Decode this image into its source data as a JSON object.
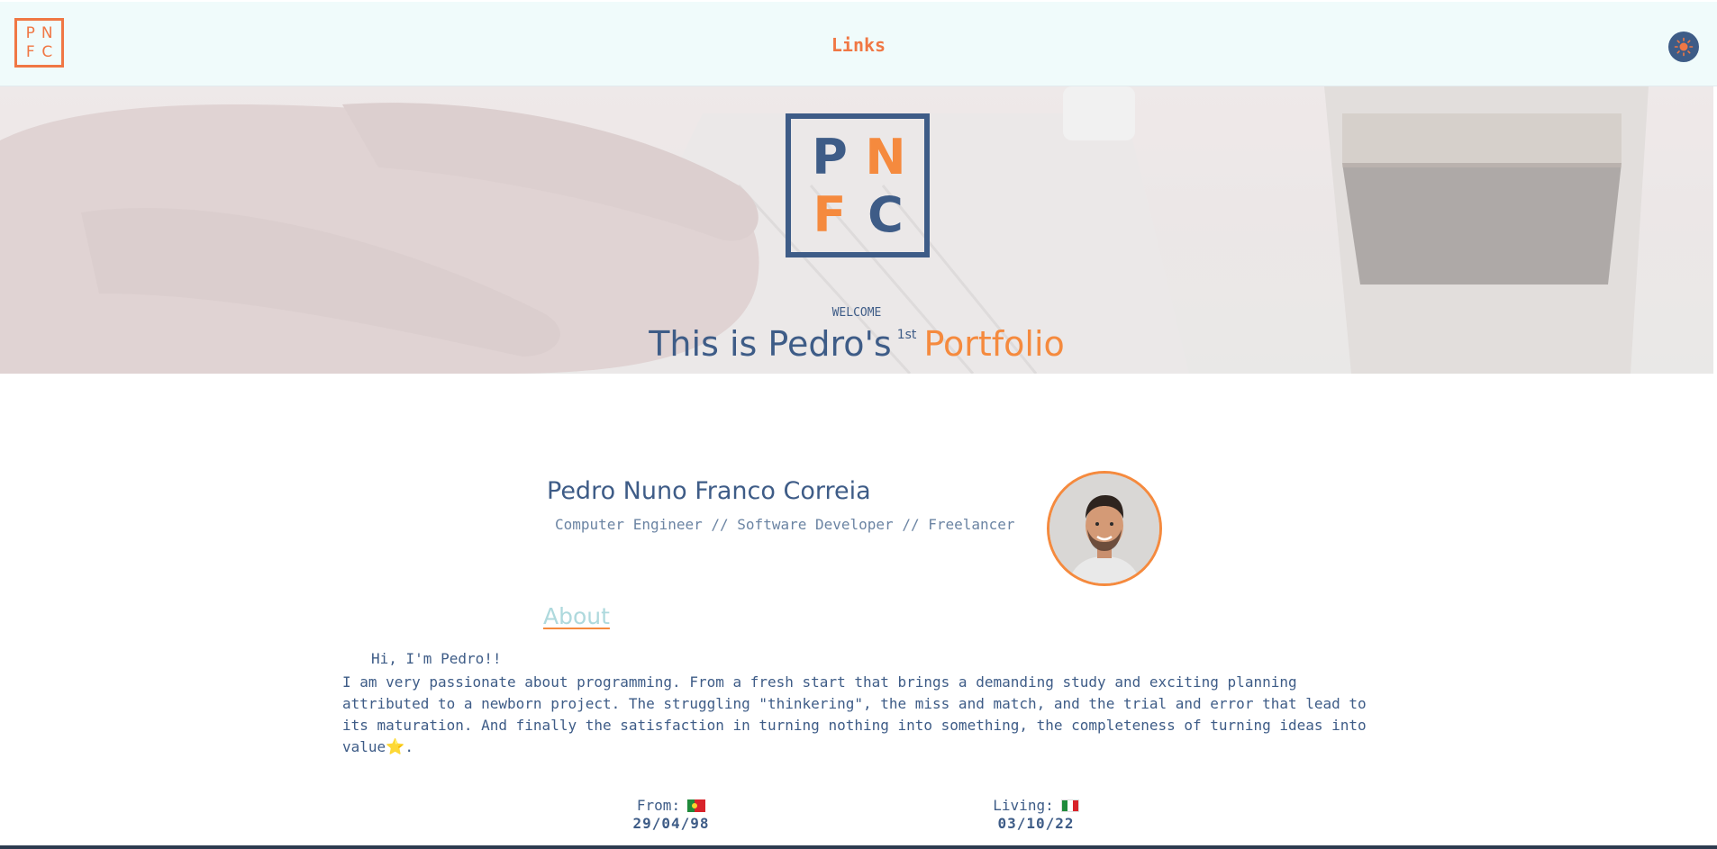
{
  "navbar": {
    "logo_letters": [
      "P",
      "N",
      "F",
      "C"
    ],
    "link_label": "Links",
    "theme_icon": "sun-icon"
  },
  "hero": {
    "logo_letters": [
      "P",
      "N",
      "F",
      "C"
    ],
    "welcome": "WELCOME",
    "title_main": "This is Pedro's",
    "title_sup": "1st",
    "title_accent": "Portfolio"
  },
  "profile": {
    "name": "Pedro Nuno Franco Correia",
    "roles": "Computer Engineer // Software Developer // Freelancer",
    "avatar_icon": "profile-photo"
  },
  "about": {
    "heading": "About",
    "greeting": "Hi, I'm Pedro!!",
    "body": "I am very passionate about programming. From a fresh start that brings a demanding study and exciting planning attributed to a newborn project. The struggling \"thinkering\", the miss and match, and the trial and error that lead to its maturation. And finally the satisfaction in turning nothing into something, the completeness of turning ideas into value",
    "star": "⭐",
    "trailing": "."
  },
  "info": {
    "from_label": "From:",
    "from_date": "29/04/98",
    "from_flag": "portugal-flag",
    "living_label": "Living:",
    "living_date": "03/10/22",
    "living_flag": "italy-flag"
  },
  "colors": {
    "accent": "#f58a3e",
    "primary": "#3e5c87",
    "nav_bg": "#f0fbfb",
    "about_link": "#aed9dd"
  }
}
